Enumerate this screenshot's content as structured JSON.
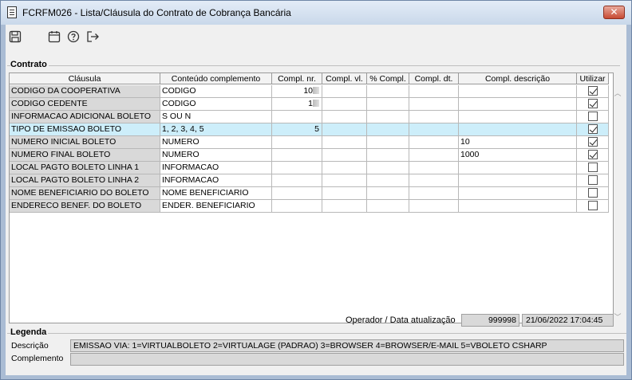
{
  "window": {
    "title": "FCRFM026 - Lista/Cláusula do Contrato de Cobrança Bancária",
    "close_label": "✕"
  },
  "toolbar": {
    "icons": [
      "save-icon",
      "calendar-icon",
      "help-icon",
      "exit-icon"
    ]
  },
  "contrato": {
    "group_label": "Contrato",
    "columns": [
      "Cláusula",
      "Conteúdo complemento",
      "Compl. nr.",
      "Compl. vl.",
      "% Compl.",
      "Compl. dt.",
      "Compl. descrição",
      "Utilizar"
    ],
    "rows": [
      {
        "clausula": "CODIGO DA COOPERATIVA",
        "conteudo": "CODIGO",
        "nr": "10",
        "nr_blurred": true,
        "vl": "",
        "pct": "",
        "dt": "",
        "descricao": "",
        "utilizar": true
      },
      {
        "clausula": "CODIGO CEDENTE",
        "conteudo": "CODIGO",
        "nr": "1",
        "nr_blurred": true,
        "vl": "",
        "pct": "",
        "dt": "",
        "descricao": "",
        "utilizar": true
      },
      {
        "clausula": "INFORMACAO ADICIONAL BOLETO",
        "conteudo": "S OU N",
        "nr": "",
        "vl": "",
        "pct": "",
        "dt": "",
        "descricao": "",
        "utilizar": false
      },
      {
        "clausula": "TIPO DE EMISSAO BOLETO",
        "conteudo": "1, 2,  3, 4, 5",
        "nr": "5",
        "vl": "",
        "pct": "",
        "dt": "",
        "descricao": "",
        "utilizar": true,
        "selected": true
      },
      {
        "clausula": "NUMERO INICIAL BOLETO",
        "conteudo": "NUMERO",
        "nr": "",
        "vl": "",
        "pct": "",
        "dt": "",
        "descricao": "10",
        "utilizar": true
      },
      {
        "clausula": "NUMERO FINAL BOLETO",
        "conteudo": "NUMERO",
        "nr": "",
        "vl": "",
        "pct": "",
        "dt": "",
        "descricao": "1000",
        "utilizar": true
      },
      {
        "clausula": "LOCAL PAGTO BOLETO LINHA 1",
        "conteudo": "INFORMACAO",
        "nr": "",
        "vl": "",
        "pct": "",
        "dt": "",
        "descricao": "",
        "utilizar": false
      },
      {
        "clausula": "LOCAL PAGTO BOLETO LINHA 2",
        "conteudo": "INFORMACAO",
        "nr": "",
        "vl": "",
        "pct": "",
        "dt": "",
        "descricao": "",
        "utilizar": false
      },
      {
        "clausula": "NOME BENEFICIARIO DO BOLETO",
        "conteudo": "NOME BENEFICIARIO",
        "nr": "",
        "vl": "",
        "pct": "",
        "dt": "",
        "descricao": "",
        "utilizar": false
      },
      {
        "clausula": "ENDERECO BENEF. DO BOLETO",
        "conteudo": "ENDER. BENEFICIARIO",
        "nr": "",
        "vl": "",
        "pct": "",
        "dt": "",
        "descricao": "",
        "utilizar": false
      }
    ]
  },
  "footer": {
    "operador_label": "Operador / Data atualização",
    "operador_value": "999998",
    "data_value": "21/06/2022 17:04:45"
  },
  "legenda": {
    "group_label": "Legenda",
    "descricao_label": "Descrição",
    "descricao_value": "EMISSAO VIA: 1=VIRTUALBOLETO 2=VIRTUALAGE (PADRAO) 3=BROWSER 4=BROWSER/E-MAIL  5=VBOLETO CSHARP",
    "complemento_label": "Complemento",
    "complemento_value": ""
  },
  "colors": {
    "selected_row": "#cdeefa",
    "title_close": "#c74a33"
  }
}
